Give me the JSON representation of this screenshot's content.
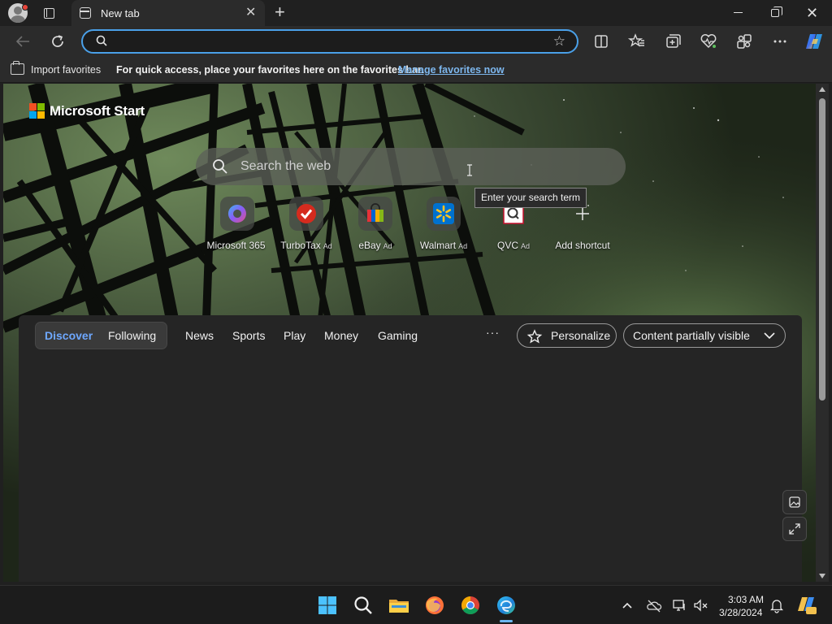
{
  "browser": {
    "tab_title": "New tab",
    "address_value": "",
    "favorites_bar": {
      "import_label": "Import favorites",
      "hint": "For quick access, place your favorites here on the favorites bar.",
      "manage_link": "Manage favorites now"
    }
  },
  "newtab": {
    "brand": "Microsoft Start",
    "search_placeholder": "Search the web",
    "tooltip": "Enter your search term",
    "shortcuts": [
      {
        "label": "Microsoft 365",
        "ad": ""
      },
      {
        "label": "TurboTax",
        "ad": "Ad"
      },
      {
        "label": "eBay",
        "ad": "Ad"
      },
      {
        "label": "Walmart",
        "ad": "Ad"
      },
      {
        "label": "QVC",
        "ad": "Ad"
      },
      {
        "label": "Add shortcut",
        "ad": ""
      }
    ],
    "feed_nav": {
      "discover": "Discover",
      "following": "Following",
      "items": [
        "News",
        "Sports",
        "Play",
        "Money",
        "Gaming"
      ],
      "more": "···",
      "personalize": "Personalize",
      "visibility": "Content partially visible"
    }
  },
  "taskbar": {
    "time": "3:03 AM",
    "date": "3/28/2024"
  },
  "colors": {
    "accent": "#4aa0e8",
    "link": "#7db7ee",
    "discover": "#6ea8ff"
  }
}
